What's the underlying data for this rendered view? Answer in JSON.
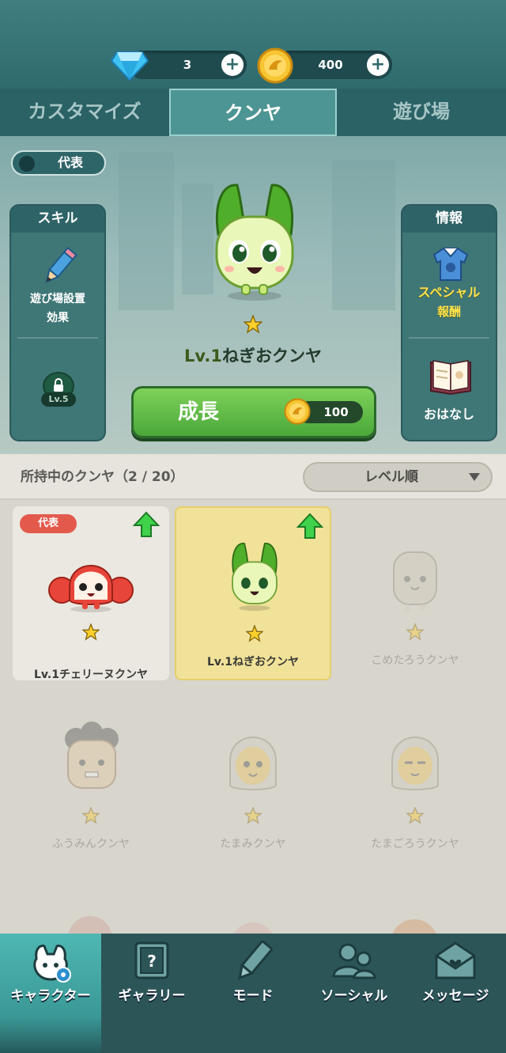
{
  "currency": {
    "gems": "3",
    "coins": "400"
  },
  "tabs": [
    {
      "label": "カスタマイズ",
      "active": false
    },
    {
      "label": "クンヤ",
      "active": true
    },
    {
      "label": "遊び場",
      "active": false
    }
  ],
  "stage": {
    "representative_toggle": "代表",
    "skill_panel": {
      "title": "スキル",
      "item_line1": "遊び場設置",
      "item_line2": "効果",
      "locked_level": "Lv.5"
    },
    "info_panel": {
      "title": "情報",
      "special_line1": "スペシャル",
      "special_line2": "報酬",
      "story": "おはなし"
    },
    "character": {
      "level": "Lv.1",
      "name": "ねぎおクンヤ"
    },
    "grow_button": {
      "label": "成長",
      "cost": "100"
    }
  },
  "collection": {
    "owned_label": "所持中のクンヤ（2 / 20）",
    "sort_label": "レベル順",
    "cards": [
      {
        "name": "Lv.1チェリーヌクンヤ",
        "badge": "代表",
        "owned": true,
        "selected": false
      },
      {
        "name": "Lv.1ねぎおクンヤ",
        "owned": true,
        "selected": true
      },
      {
        "name": "こめたろうクンヤ",
        "owned": false
      },
      {
        "name": "ふうみんクンヤ",
        "owned": false
      },
      {
        "name": "たまみクンヤ",
        "owned": false
      },
      {
        "name": "たまごろうクンヤ",
        "owned": false
      }
    ]
  },
  "nav": [
    {
      "label": "キャラクター",
      "icon": "character-icon",
      "active": true
    },
    {
      "label": "ギャラリー",
      "icon": "gallery-icon",
      "active": false
    },
    {
      "label": "モード",
      "icon": "pencil-icon",
      "active": false
    },
    {
      "label": "ソーシャル",
      "icon": "people-icon",
      "active": false
    },
    {
      "label": "メッセージ",
      "icon": "envelope-icon",
      "active": false
    }
  ],
  "colors": {
    "accent_teal": "#2f6a6d",
    "grow_green": "#4aa83a",
    "selected_card": "#f1e29a",
    "badge_red": "#e35a4c"
  }
}
